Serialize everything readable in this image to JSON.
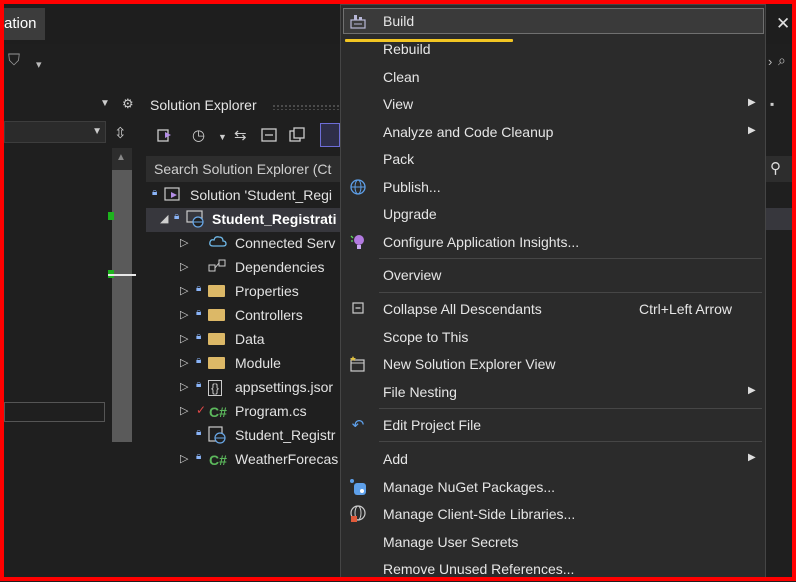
{
  "window": {
    "tab_label": "ation",
    "close_glyph": "✕"
  },
  "solution_explorer": {
    "title": "Solution Explorer",
    "search_placeholder": "Search Solution Explorer (Ct",
    "tree": [
      {
        "label": "Solution 'Student_Regi",
        "icon": "solution-icon"
      },
      {
        "label": "Student_Registrati",
        "icon": "web-project-icon",
        "selected": true,
        "bold": true
      },
      {
        "label": "Connected Serv",
        "icon": "cloud-icon"
      },
      {
        "label": "Dependencies",
        "icon": "dependencies-icon"
      },
      {
        "label": "Properties",
        "icon": "properties-icon"
      },
      {
        "label": "Controllers",
        "icon": "folder-icon"
      },
      {
        "label": "Data",
        "icon": "folder-icon"
      },
      {
        "label": "Module",
        "icon": "folder-icon"
      },
      {
        "label": "appsettings.jsor",
        "icon": "json-file-icon"
      },
      {
        "label": "Program.cs",
        "icon": "csharp-file-icon"
      },
      {
        "label": "Student_Registr",
        "icon": "web-file-icon"
      },
      {
        "label": "WeatherForecas",
        "icon": "csharp-file-icon"
      }
    ],
    "cs_glyph": "C#"
  },
  "context_menu": {
    "items": [
      {
        "label": "Build",
        "icon": "build-icon"
      },
      {
        "label": "Rebuild"
      },
      {
        "label": "Clean"
      },
      {
        "label": "View",
        "submenu": true
      },
      {
        "label": "Analyze and Code Cleanup",
        "submenu": true
      },
      {
        "label": "Pack"
      },
      {
        "label": "Publish...",
        "icon": "publish-globe-icon"
      },
      {
        "label": "Upgrade"
      },
      {
        "label": "Configure Application Insights...",
        "icon": "insights-bulb-icon"
      },
      {
        "label": "Overview"
      },
      {
        "label": "Collapse All Descendants",
        "icon": "collapse-icon",
        "shortcut": "Ctrl+Left Arrow"
      },
      {
        "label": "Scope to This"
      },
      {
        "label": "New Solution Explorer View",
        "icon": "new-view-icon"
      },
      {
        "label": "File Nesting",
        "submenu": true
      },
      {
        "label": "Edit Project File",
        "icon": "edit-arrow-icon"
      },
      {
        "label": "Add",
        "submenu": true
      },
      {
        "label": "Manage NuGet Packages...",
        "icon": "nuget-icon"
      },
      {
        "label": "Manage Client-Side Libraries...",
        "icon": "client-libraries-icon"
      },
      {
        "label": "Manage User Secrets"
      },
      {
        "label": "Remove Unused References..."
      }
    ]
  },
  "colors": {
    "highlight_underline": "#f3c623",
    "frame_border": "#ff0000",
    "selected_row": "#37373d"
  }
}
